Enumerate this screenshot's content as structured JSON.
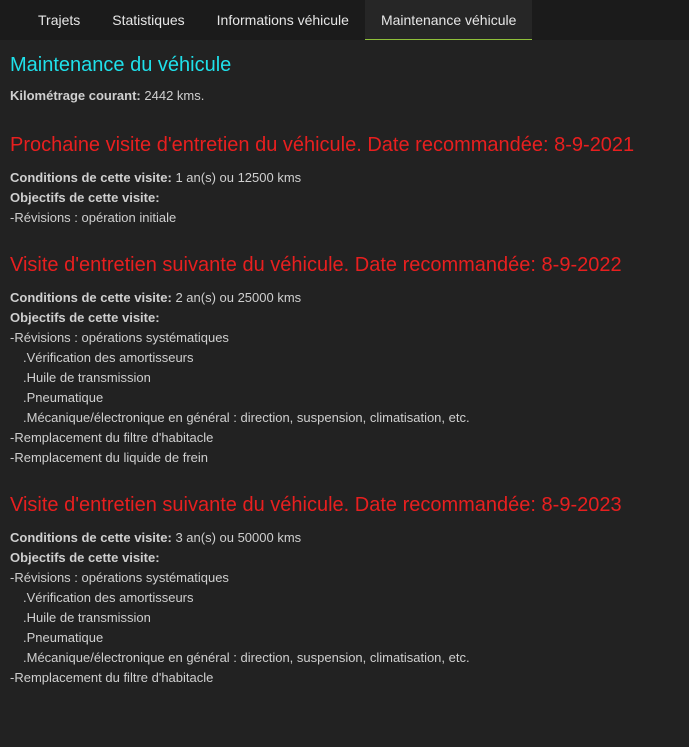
{
  "tabs": [
    {
      "label": "Trajets",
      "active": false
    },
    {
      "label": "Statistiques",
      "active": false
    },
    {
      "label": "Informations véhicule",
      "active": false
    },
    {
      "label": "Maintenance véhicule",
      "active": true
    }
  ],
  "page": {
    "title": "Maintenance du véhicule",
    "mileage_label": "Kilométrage courant:",
    "mileage_value": "2442 kms."
  },
  "labels": {
    "conditions": "Conditions de cette visite:",
    "objectives": "Objectifs de cette visite:"
  },
  "visits": [
    {
      "title": "Prochaine visite d'entretien du véhicule. Date recommandée: 8-9-2021",
      "conditions": "1 an(s) ou 12500 kms",
      "objectives": [
        "-Révisions : opération initiale"
      ]
    },
    {
      "title": "Visite d'entretien suivante du véhicule. Date recommandée: 8-9-2022",
      "conditions": "2 an(s) ou 25000 kms",
      "objectives": [
        "-Révisions : opérations systématiques",
        ".Vérification des amortisseurs",
        ".Huile de transmission",
        ".Pneumatique",
        ".Mécanique/électronique en général : direction, suspension, climatisation, etc.",
        "-Remplacement du filtre d'habitacle",
        "-Remplacement du liquide de frein"
      ]
    },
    {
      "title": "Visite d'entretien suivante du véhicule. Date recommandée: 8-9-2023",
      "conditions": "3 an(s) ou 50000 kms",
      "objectives": [
        "-Révisions : opérations systématiques",
        ".Vérification des amortisseurs",
        ".Huile de transmission",
        ".Pneumatique",
        ".Mécanique/électronique en général : direction, suspension, climatisation, etc.",
        "-Remplacement du filtre d'habitacle"
      ]
    }
  ],
  "colors": {
    "accent_title": "#1fe0ea",
    "section_title": "#e81f1f",
    "active_tab_underline": "#8fc03a",
    "background": "#222222"
  }
}
